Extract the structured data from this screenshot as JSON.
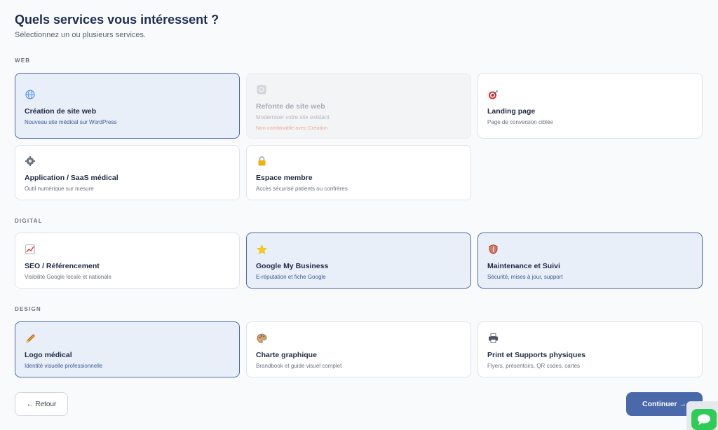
{
  "header": {
    "title": "Quels services vous intéressent ?",
    "subtitle": "Sélectionnez un ou plusieurs services."
  },
  "sections": {
    "web": {
      "label": "WEB",
      "cards": [
        {
          "name": "Création de site web",
          "desc": "Nouveau site médical sur WordPress",
          "icon": "globe-icon",
          "selected": true
        },
        {
          "name": "Refonte de site web",
          "desc": "Moderniser votre site existant",
          "warning": "Non combinable avec Création",
          "icon": "refresh-icon",
          "disabled": true
        },
        {
          "name": "Landing page",
          "desc": "Page de conversion ciblée",
          "icon": "target-icon",
          "selected": false
        },
        {
          "name": "Application / SaaS médical",
          "desc": "Outil numérique sur mesure",
          "icon": "gear-icon",
          "selected": false
        },
        {
          "name": "Espace membre",
          "desc": "Accès sécurisé patients ou confrères",
          "icon": "lock-icon",
          "selected": false
        }
      ]
    },
    "digital": {
      "label": "DIGITAL",
      "cards": [
        {
          "name": "SEO / Référencement",
          "desc": "Visibilité Google locale et nationale",
          "icon": "chart-icon",
          "selected": false
        },
        {
          "name": "Google My Business",
          "desc": "E-réputation et fiche Google",
          "icon": "star-icon",
          "selected": true
        },
        {
          "name": "Maintenance et Suivi",
          "desc": "Sécurité, mises à jour, support",
          "icon": "shield-icon",
          "selected": true
        }
      ]
    },
    "design": {
      "label": "DESIGN",
      "cards": [
        {
          "name": "Logo médical",
          "desc": "Identité visuelle professionnelle",
          "icon": "pencil-icon",
          "selected": true
        },
        {
          "name": "Charte graphique",
          "desc": "Brandbook et guide visuel complet",
          "icon": "palette-icon",
          "selected": false
        },
        {
          "name": "Print et Supports physiques",
          "desc": "Flyers, présentoirs, QR codes, cartes",
          "icon": "printer-icon",
          "selected": false
        }
      ]
    }
  },
  "footer": {
    "back_label": "← Retour",
    "continue_label": "Continuer →"
  },
  "colors": {
    "accent": "#4a69ab",
    "selected_bg": "#e9eff9",
    "chat_green": "#2ecc57"
  }
}
